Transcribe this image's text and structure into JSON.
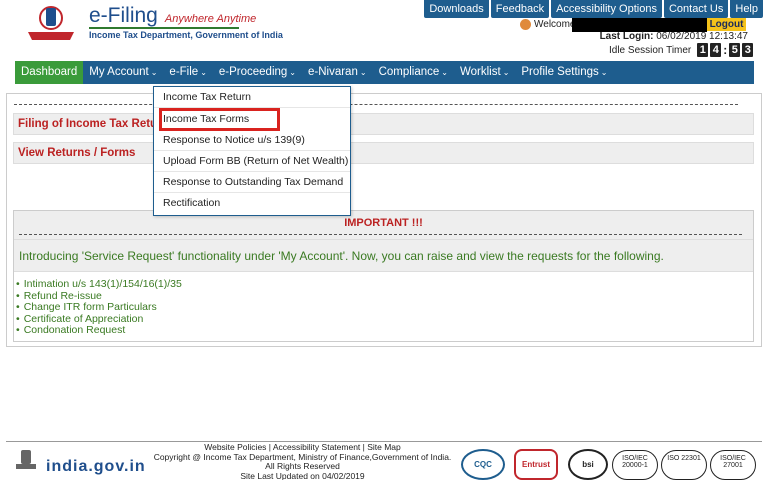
{
  "header": {
    "brand_title": "e-Filing",
    "brand_tagline": "Anywhere Anytime",
    "brand_subtitle": "Income Tax Department, Government of India",
    "welcome_label": "Welcome",
    "logout_label": "Logout",
    "last_login_label": "Last Login:",
    "last_login_value": "06/02/2019 12:13:47",
    "idle_label": "Idle Session Timer",
    "idle_digits": [
      "1",
      "4",
      "5",
      "3"
    ]
  },
  "topnav": {
    "items": [
      "Downloads",
      "Feedback",
      "Accessibility Options",
      "Contact Us",
      "Help"
    ]
  },
  "mainnav": {
    "items": [
      "Dashboard",
      "My Account",
      "e-File",
      "e-Proceeding",
      "e-Nivaran",
      "Compliance",
      "Worklist",
      "Profile Settings"
    ],
    "active": "Dashboard"
  },
  "sections": {
    "filing_label": "Filing of Income Tax Return",
    "view_label": "View Returns / Forms"
  },
  "dropdown": {
    "items": [
      "Income Tax Return",
      "Income Tax Forms",
      "Response to Notice u/s 139(9)",
      "Upload Form BB (Return of Net Wealth)",
      "Response to Outstanding Tax Demand",
      "Rectification"
    ],
    "highlighted": "Income Tax Forms"
  },
  "important": {
    "heading": "IMPORTANT !!!",
    "intro": "Introducing 'Service Request' functionality under 'My Account'. Now, you can raise and view the requests for the following.",
    "list": [
      "Intimation u/s 143(1)/154/16(1)/35",
      "Refund Re-issue",
      "Change ITR form Particulars",
      "Certificate of Appreciation",
      "Condonation Request"
    ]
  },
  "footer": {
    "links": "Website Policies  |  Accessibility Statement  |  Site Map",
    "copyright": "Copyright @ Income Tax Department, Ministry of Finance,Government of India.",
    "rights": "All Rights Reserved",
    "updated": "Site Last Updated on 04/02/2019",
    "cert_labels": [
      "CQC",
      "Entrust",
      "bsi",
      "ISO/IEC 20000-1",
      "ISO 22301",
      "ISO/IEC 27001"
    ]
  },
  "colors": {
    "nav_blue": "#1e5d8e",
    "active_green": "#3a9b3a",
    "alert_red": "#b22222",
    "text_green": "#3a7a22",
    "logout_yellow": "#f5c21a"
  }
}
